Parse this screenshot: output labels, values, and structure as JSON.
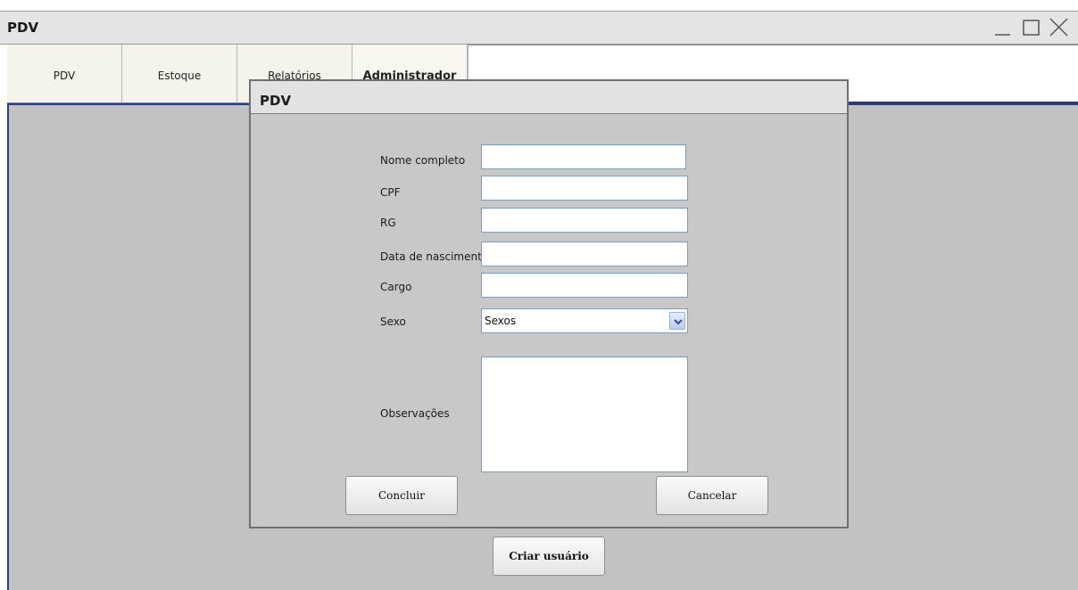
{
  "window": {
    "title": "PDV",
    "controls": [
      "minimize-icon",
      "maximize-icon",
      "close-icon"
    ]
  },
  "tabs": [
    {
      "label": "PDV"
    },
    {
      "label": "Estoque"
    },
    {
      "label": "Relatórios"
    },
    {
      "label": "Administrador",
      "active": true
    }
  ],
  "main": {
    "create_user_button": "Criar usuário"
  },
  "dialog": {
    "title": "PDV",
    "fields": {
      "nome_completo": {
        "label": "Nome completo",
        "value": ""
      },
      "cpf": {
        "label": "CPF",
        "value": ""
      },
      "rg": {
        "label": "RG",
        "value": ""
      },
      "data_nascimento": {
        "label": "Data de nascimento",
        "value": ""
      },
      "cargo": {
        "label": "Cargo",
        "value": ""
      },
      "sexo": {
        "label": "Sexo",
        "selected": "Sexos"
      },
      "observacoes": {
        "label": "Observações",
        "value": ""
      }
    },
    "buttons": {
      "ok": "Concluir",
      "cancel": "Cancelar"
    }
  },
  "colors": {
    "content_bg": "#c2c2c2",
    "accent_border": "#2c3f8a",
    "field_border": "#7f9db9"
  }
}
